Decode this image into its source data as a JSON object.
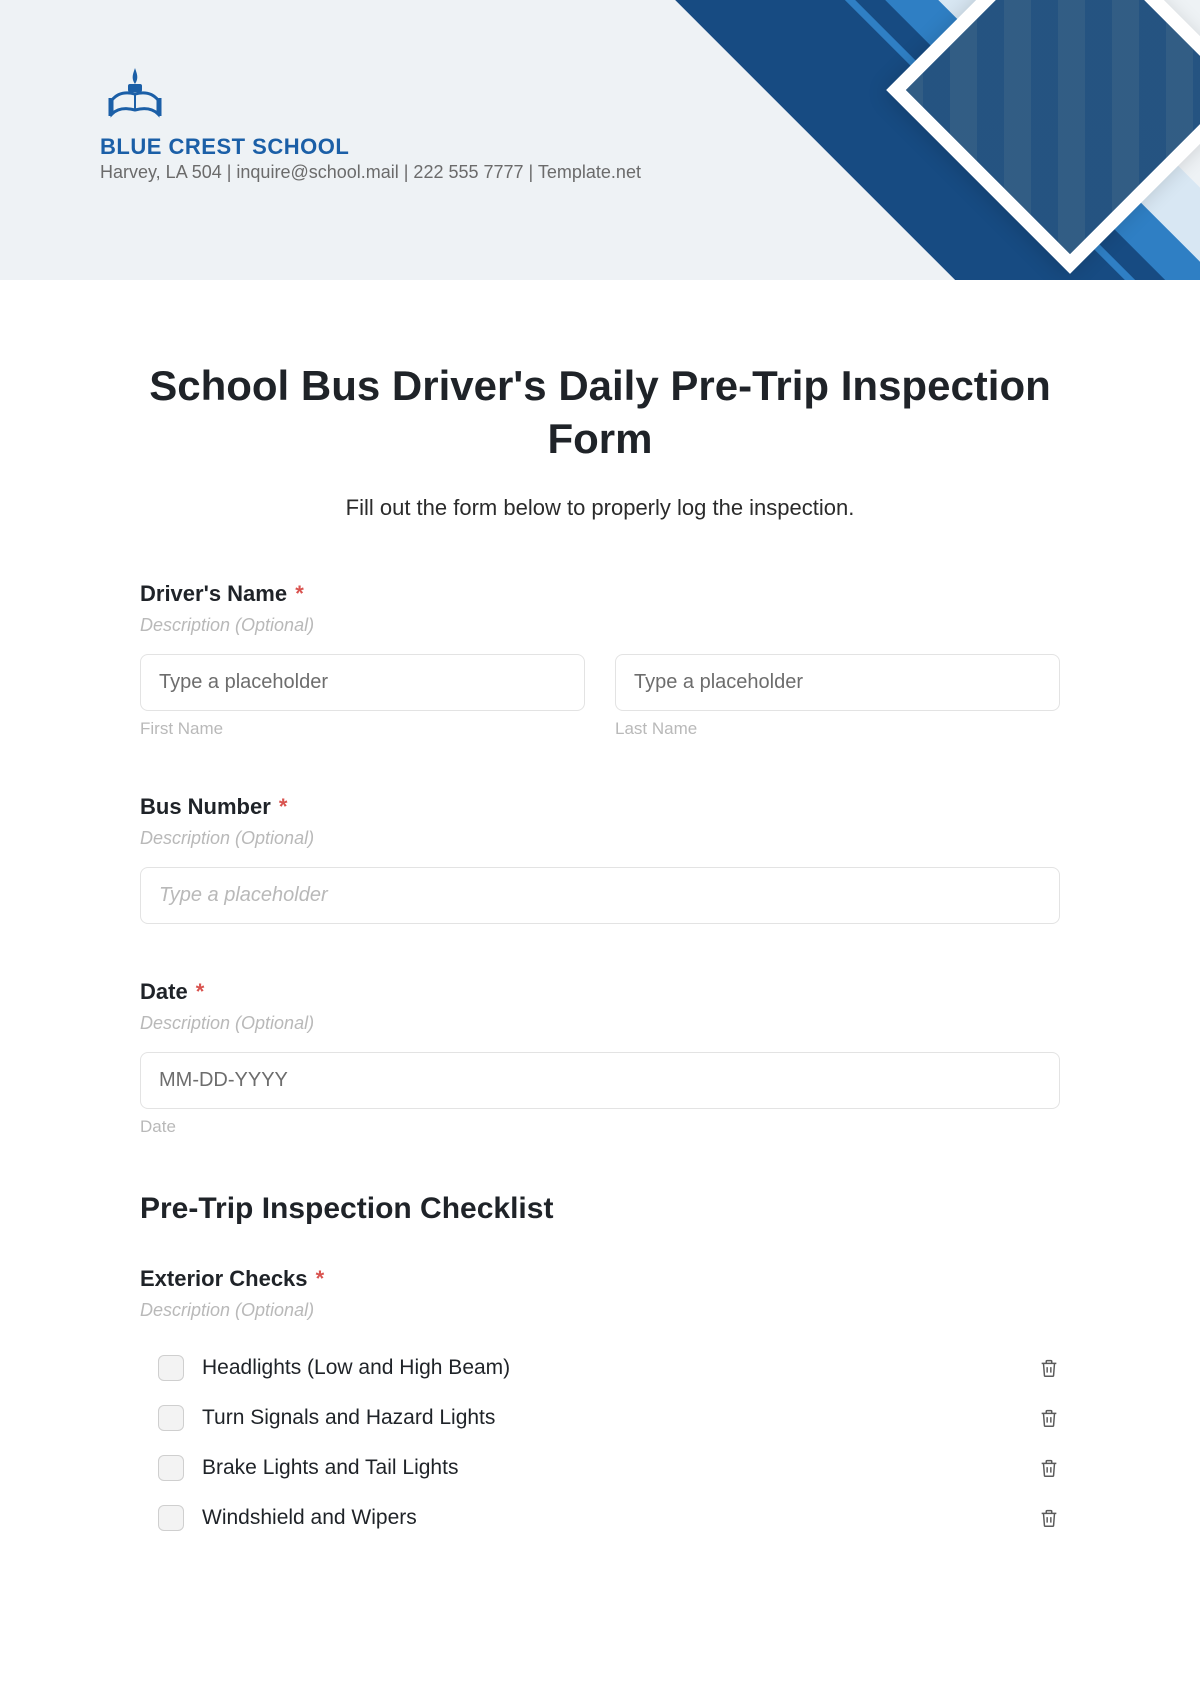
{
  "header": {
    "school_name": "BLUE CREST SCHOOL",
    "info_line": "Harvey, LA 504 | inquire@school.mail | 222 555 7777 | Template.net"
  },
  "form": {
    "title": "School Bus Driver's Daily Pre-Trip Inspection Form",
    "subtitle": "Fill out the form below to properly log the inspection.",
    "driver_name": {
      "label": "Driver's Name",
      "desc": "Description (Optional)",
      "first_placeholder": "Type a placeholder",
      "first_sublabel": "First Name",
      "last_placeholder": "Type a placeholder",
      "last_sublabel": "Last Name"
    },
    "bus_number": {
      "label": "Bus Number",
      "desc": "Description (Optional)",
      "placeholder": "Type a placeholder"
    },
    "date": {
      "label": "Date",
      "desc": "Description (Optional)",
      "placeholder": "MM-DD-YYYY",
      "sublabel": "Date"
    },
    "checklist_heading": "Pre-Trip Inspection Checklist",
    "exterior": {
      "label": "Exterior Checks",
      "desc": "Description (Optional)",
      "items": [
        "Headlights (Low and High Beam)",
        "Turn Signals and Hazard Lights",
        "Brake Lights and Tail Lights",
        "Windshield and Wipers"
      ]
    }
  }
}
